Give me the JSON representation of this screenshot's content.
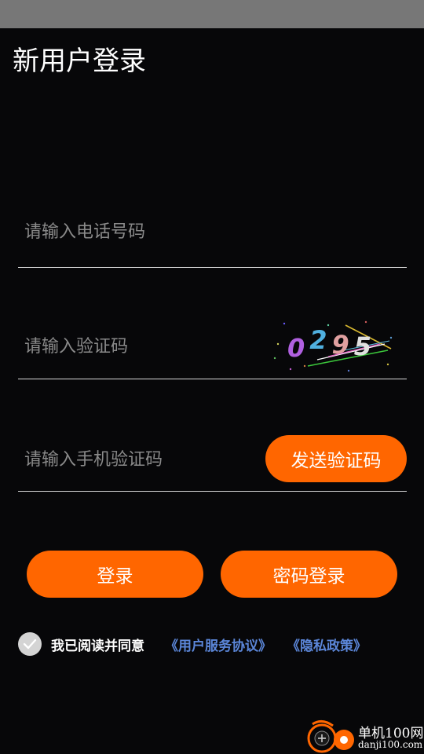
{
  "header": {
    "title": "新用户登录"
  },
  "form": {
    "phone_placeholder": "请输入电话号码",
    "captcha_placeholder": "请输入验证码",
    "captcha_text": "0295",
    "sms_placeholder": "请输入手机验证码",
    "send_code_label": "发送验证码"
  },
  "actions": {
    "login_label": "登录",
    "password_login_label": "密码登录"
  },
  "agreement": {
    "checked": true,
    "text": "我已阅读并同意",
    "terms_link": "《用户服务协议》",
    "privacy_link": "《隐私政策》"
  },
  "watermark": {
    "name": "单机100网",
    "url": "danji100.com"
  },
  "colors": {
    "background": "#070709",
    "status_bar": "#777777",
    "accent": "#ff6600",
    "link": "#5b86d8"
  },
  "icons": {
    "checkbox": "check-icon",
    "watermark": "danji100-logo-icon"
  }
}
